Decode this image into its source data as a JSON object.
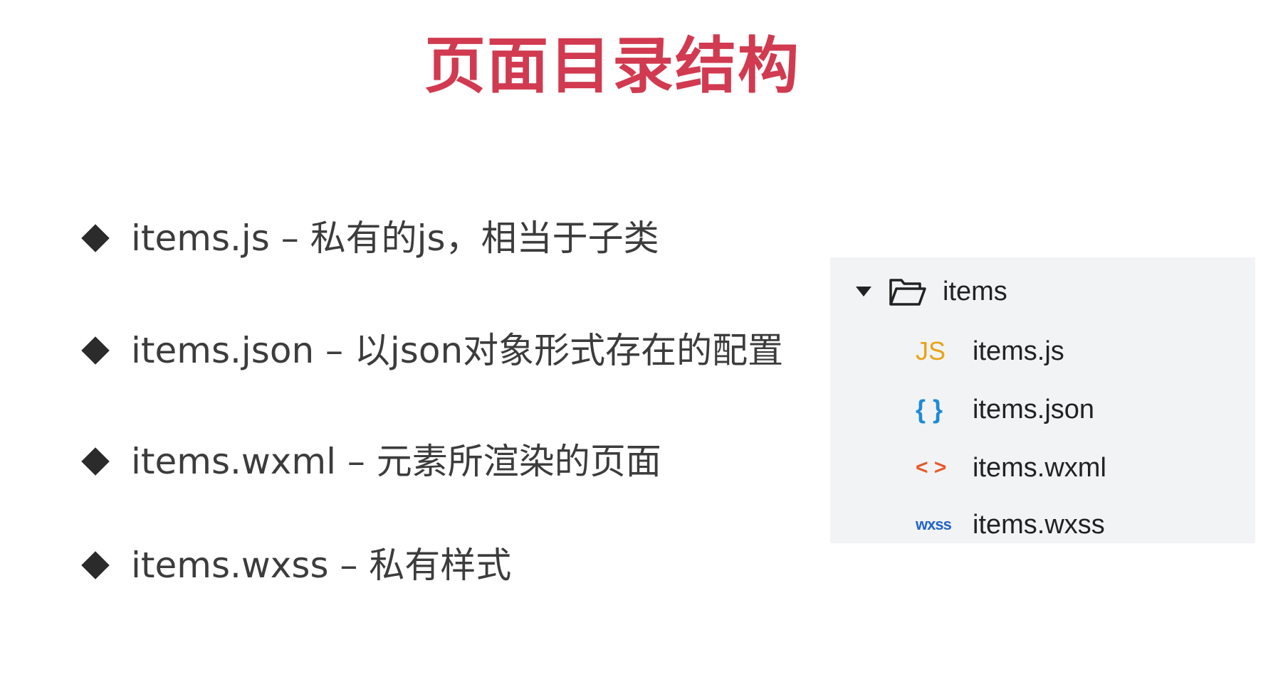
{
  "title": "页面目录结构",
  "bullets": [
    {
      "text": "items.js – 私有的js，相当于子类"
    },
    {
      "text": "items.json – 以json对象形式存在的配置"
    },
    {
      "text": "items.wxml – 元素所渲染的页面"
    },
    {
      "text": "items.wxss – 私有样式"
    }
  ],
  "file_tree": {
    "folder": {
      "name": "items",
      "icon": "folder-open-icon",
      "expanded": true
    },
    "files": [
      {
        "icon_text": "JS",
        "icon": "js-file-icon",
        "name": "items.js",
        "color": "#e8a317"
      },
      {
        "icon_text": "{ }",
        "icon": "json-file-icon",
        "name": "items.json",
        "color": "#1f8bd6"
      },
      {
        "icon_text": "< >",
        "icon": "wxml-file-icon",
        "name": "items.wxml",
        "color": "#e55b2b"
      },
      {
        "icon_text": "wxss",
        "icon": "wxss-file-icon",
        "name": "items.wxss",
        "color": "#2164c7"
      }
    ]
  },
  "colors": {
    "title": "#d13a50",
    "body_text": "#3c3c3c",
    "panel_bg": "#f2f3f4"
  }
}
